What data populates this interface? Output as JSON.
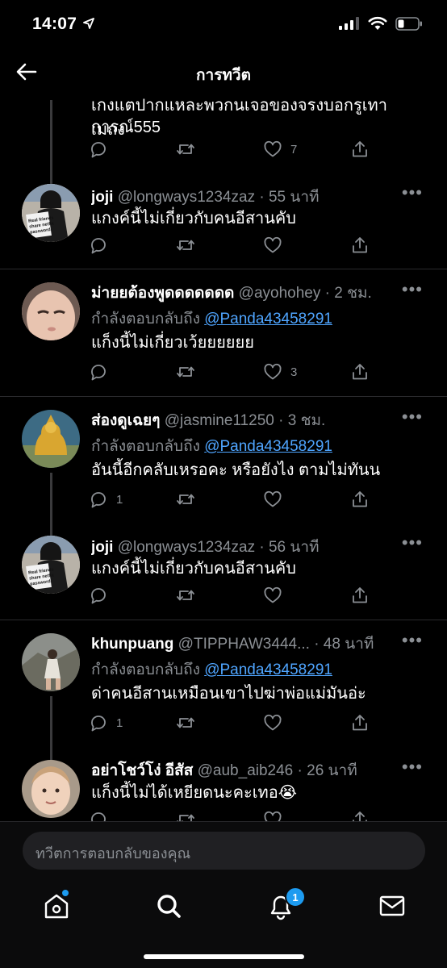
{
  "status": {
    "time": "14:07"
  },
  "header": {
    "title": "การทวีต"
  },
  "first_tweet": {
    "text_line1": "เกงแตปากแหละพวกนเจอของจรงบอกรูเทาเมถง",
    "text_line2": "การณ์555",
    "likes": "7"
  },
  "tweets": [
    {
      "name": "joji",
      "handle": "@longways1234zaz · 55 นาที",
      "reply_to_prefix": "",
      "reply_to_mention": "",
      "text": "แกงค์นี้ไม่เกี่ยวกับคนอีสานคับ",
      "replies": "",
      "likes": ""
    },
    {
      "name": "ม่ายยต้องพูดดดดดดด",
      "handle": "@ayohohey · 2 ชม.",
      "reply_to_prefix": "กำลังตอบกลับถึง",
      "reply_to_mention": "@Panda43458291",
      "text": "แก็งนี้ไม่เกี่ยวเว้ยยยยยย",
      "replies": "",
      "likes": "3"
    },
    {
      "name": "ส่องดูเฉยๆ",
      "handle": "@jasmine11250 · 3 ชม.",
      "reply_to_prefix": "กำลังตอบกลับถึง",
      "reply_to_mention": "@Panda43458291",
      "text": "อันนี้อีกคลับเหรอคะ หรือยังไง ตามไม่ทันน",
      "replies": "1",
      "likes": ""
    },
    {
      "name": "joji",
      "handle": "@longways1234zaz · 56 นาที",
      "reply_to_prefix": "",
      "reply_to_mention": "",
      "text": "แกงค์นี้ไม่เกี่ยวกับคนอีสานคับ",
      "replies": "",
      "likes": ""
    },
    {
      "name": "khunpuang",
      "handle": "@TIPPHAW3444... · 48 นาที",
      "reply_to_prefix": "กำลังตอบกลับถึง",
      "reply_to_mention": "@Panda43458291",
      "text": "ด่าคนอีสานเหมือนเขาไปฆ่าพ่อแม่มันอ่ะ",
      "replies": "1",
      "likes": ""
    },
    {
      "name": "อย่าโชว์โง่ อีสัส",
      "handle": "@aub_aib246 · 26 นาที",
      "reply_to_prefix": "",
      "reply_to_mention": "",
      "text": "แก็งนี้ไม่ได้เหยียดนะคะเทอ😭",
      "replies": "",
      "likes": ""
    }
  ],
  "avatar_sign": {
    "text": "Real friends share netfix password"
  },
  "compose": {
    "placeholder": "ทวีตการตอบกลับของคุณ"
  },
  "tabbar": {
    "notifications_badge": "1"
  },
  "icons": {
    "back": "arrow-left-icon",
    "reply": "reply-icon",
    "retweet": "retweet-icon",
    "like": "heart-icon",
    "share": "share-icon",
    "more": "more-icon",
    "home": "home-icon",
    "search": "search-icon",
    "notifications": "bell-icon",
    "messages": "mail-icon"
  },
  "colors": {
    "background": "#000000",
    "link": "#4fa5ff",
    "muted": "#8b8f94",
    "badge": "#1d9bf0"
  }
}
